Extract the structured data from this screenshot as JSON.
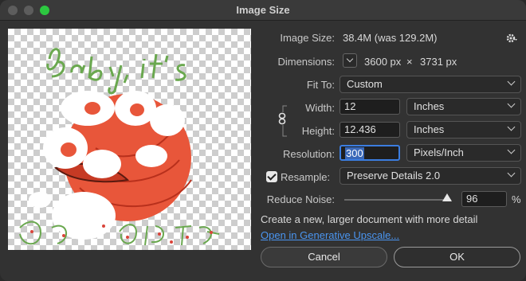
{
  "window": {
    "title": "Image Size"
  },
  "image_size": {
    "label": "Image Size:",
    "value": "38.4M (was 129.2M)"
  },
  "dimensions": {
    "label": "Dimensions:",
    "width": "3600 px",
    "times": "×",
    "height": "3731 px"
  },
  "fit_to": {
    "label": "Fit To:",
    "value": "Custom"
  },
  "width": {
    "label": "Width:",
    "value": "12",
    "unit": "Inches"
  },
  "height": {
    "label": "Height:",
    "value": "12.436",
    "unit": "Inches"
  },
  "resolution": {
    "label": "Resolution:",
    "value": "300",
    "unit": "Pixels/Inch"
  },
  "resample": {
    "label": "Resample:",
    "checked": true,
    "method": "Preserve Details 2.0"
  },
  "reduce_noise": {
    "label": "Reduce Noise:",
    "value": "96",
    "percent": "%",
    "slider_fraction": 0.96
  },
  "info_text": "Create a new, larger document with more detail",
  "upscale_link": "Open in Generative Upscale...",
  "buttons": {
    "cancel": "Cancel",
    "ok": "OK"
  },
  "preview": {
    "artwork_text": "Baby, it's COLD",
    "colors": {
      "fox": "#e8563a",
      "lettering": "#6aa84f",
      "snow": "#ffffff"
    }
  },
  "colors": {
    "accent": "#3b7de0",
    "link": "#4a95f0"
  }
}
